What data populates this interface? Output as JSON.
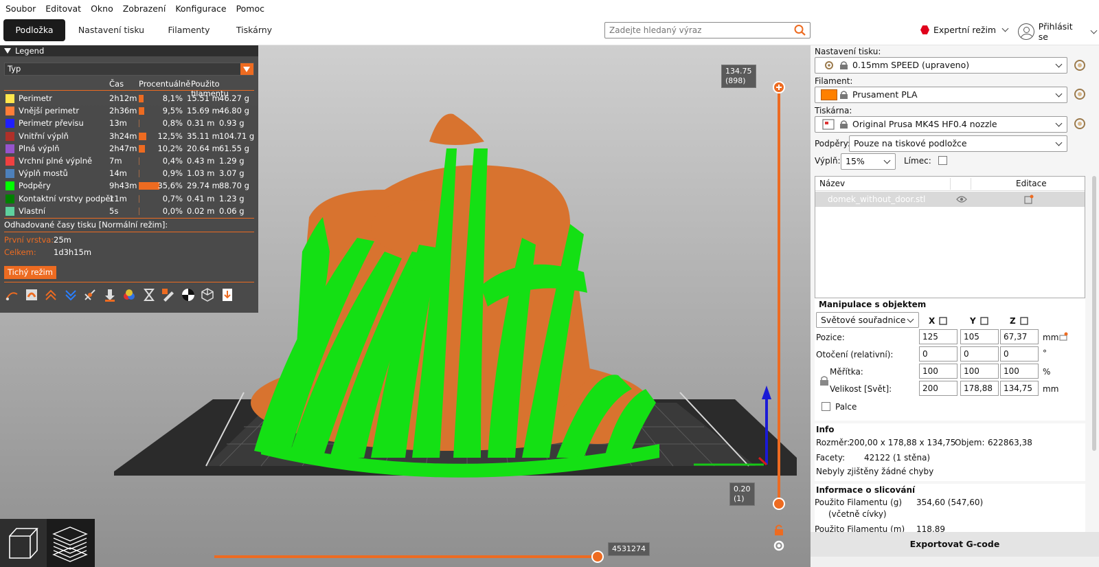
{
  "menu": [
    "Soubor",
    "Editovat",
    "Okno",
    "Zobrazení",
    "Konfigurace",
    "Pomoc"
  ],
  "tabs": [
    "Podložka",
    "Nastavení tisku",
    "Filamenty",
    "Tiskárny"
  ],
  "search": {
    "placeholder": "Zadejte hledaný výraz"
  },
  "mode": {
    "label": "Expertní režim",
    "color": "#e0001b"
  },
  "account": {
    "label": "Přihlásit se"
  },
  "legend": {
    "title": "Legend",
    "view_type": "Typ",
    "columns": [
      "Čas",
      "Procentuálně",
      "Použito filamentu"
    ],
    "rows": [
      {
        "name": "Perimetr",
        "color": "#ffe64d",
        "time": "2h12m",
        "percent": "8,1%",
        "share": 0.081,
        "length": "15.51 m",
        "weight": "46.27 g"
      },
      {
        "name": "Vnější perimetr",
        "color": "#ff7d38",
        "time": "2h36m",
        "percent": "9,5%",
        "share": 0.095,
        "length": "15.69 m",
        "weight": "46.80 g"
      },
      {
        "name": "Perimetr převisu",
        "color": "#1f1fff",
        "time": "13m",
        "percent": "0,8%",
        "share": 0.008,
        "length": "0.31 m",
        "weight": "0.93 g"
      },
      {
        "name": "Vnitřní výplň",
        "color": "#b03029",
        "time": "3h24m",
        "percent": "12,5%",
        "share": 0.125,
        "length": "35.11 m",
        "weight": "104.71 g"
      },
      {
        "name": "Plná výplň",
        "color": "#9654cc",
        "time": "2h47m",
        "percent": "10,2%",
        "share": 0.102,
        "length": "20.64 m",
        "weight": "61.55 g"
      },
      {
        "name": "Vrchní plné výplně",
        "color": "#f04040",
        "time": "7m",
        "percent": "0,4%",
        "share": 0.004,
        "length": "0.43 m",
        "weight": "1.29 g"
      },
      {
        "name": "Výplň mostů",
        "color": "#4d80ba",
        "time": "14m",
        "percent": "0,9%",
        "share": 0.009,
        "length": "1.03 m",
        "weight": "3.07 g"
      },
      {
        "name": "Podpěry",
        "color": "#00ff00",
        "time": "9h43m",
        "percent": "35,6%",
        "share": 0.356,
        "length": "29.74 m",
        "weight": "88.70 g"
      },
      {
        "name": "Kontaktní vrstvy podpěr",
        "color": "#008000",
        "time": "11m",
        "percent": "0,7%",
        "share": 0.007,
        "length": "0.41 m",
        "weight": "1.23 g"
      },
      {
        "name": "Vlastní",
        "color": "#5ed19e",
        "time": "5s",
        "percent": "0,0%",
        "share": 0.0,
        "length": "0.02 m",
        "weight": "0.06 g"
      }
    ],
    "estimate_title": "Odhadované časy tisku [Normální režim]:",
    "first_layer_label": "První vrstva:",
    "first_layer_value": "25m",
    "total_label": "Celkem:",
    "total_value": "1d3h15m",
    "quiet_button": "Tichý režim"
  },
  "slider": {
    "top": "134.75",
    "top_layer": "(898)",
    "bottom": "0.20",
    "bottom_layer": "(1)",
    "horizontal": "4531274"
  },
  "panel": {
    "print_label": "Nastavení tisku:",
    "print_value": "0.15mm SPEED (upraveno)",
    "filament_label": "Filament:",
    "filament_value": "Prusament PLA",
    "filament_color": "#ff8000",
    "printer_label": "Tiskárna:",
    "printer_value": "Original Prusa MK4S HF0.4 nozzle",
    "supports_label": "Podpěry:",
    "supports_value": "Pouze na tiskové podložce",
    "infill_label": "Výplň:",
    "infill_value": "15%",
    "brim_label": "Límec:",
    "list_name": "Název",
    "list_edit": "Editace",
    "object_name": "domek_without_door.stl"
  },
  "manip": {
    "title": "Manipulace s objektem",
    "coords": "Světové souřadnice",
    "axes": [
      "X",
      "Y",
      "Z"
    ],
    "position_label": "Pozice:",
    "position": [
      "125",
      "105",
      "67,37"
    ],
    "position_unit": "mm",
    "rotation_label": "Otočení (relativní):",
    "rotation": [
      "0",
      "0",
      "0"
    ],
    "rotation_unit": "°",
    "scale_label": "Měřítka:",
    "scale": [
      "100",
      "100",
      "100"
    ],
    "scale_unit": "%",
    "size_label": "Velikost [Svět]:",
    "size": [
      "200",
      "178,88",
      "134,75"
    ],
    "size_unit": "mm",
    "inches_label": "Palce"
  },
  "info": {
    "title": "Info",
    "size_label": "Rozměr:",
    "size_value": "200,00 x 178,88 x 134,75",
    "volume_label": "Objem:",
    "volume_value": "622863,38",
    "facets_label": "Facety:",
    "facets_value": "42122 (1 stěna)",
    "errors": "Nebyly zjištěny žádné chyby"
  },
  "slicing": {
    "title": "Informace o slicování",
    "used_g_label": "Použito Filamentu (g)",
    "used_g_sub": "(včetně cívky)",
    "used_g_value": "354,60 (547,60)",
    "used_m_label": "Použito Filamentu (m)",
    "used_m_value": "118,89"
  },
  "export": "Exportovat G-code"
}
